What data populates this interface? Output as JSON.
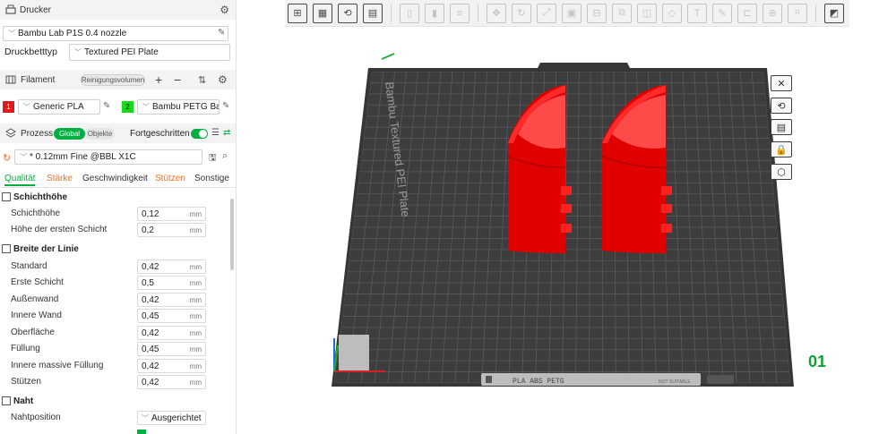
{
  "printer": {
    "section_title": "Drucker",
    "name": "Bambu Lab P1S 0.4 nozzle",
    "bed_type_label": "Druckbetttyp",
    "bed_type": "Textured PEI Plate"
  },
  "filament": {
    "section_title": "Filament",
    "flush_button": "Reinigungsvolumen",
    "slots": [
      {
        "number": "1",
        "name": "Generic PLA",
        "color": "#e01b1b"
      },
      {
        "number": "2",
        "name": "Bambu PETG Basic",
        "color": "#19d819"
      }
    ]
  },
  "process": {
    "section_title": "Prozess",
    "toggle_global": "Global",
    "toggle_objects": "Objekte",
    "advanced_label": "Fortgeschritten",
    "preset": "* 0.12mm Fine @BBL X1C"
  },
  "tabs": [
    {
      "label": "Qualität",
      "active": true
    },
    {
      "label": "Stärke",
      "active": false,
      "modified": true
    },
    {
      "label": "Geschwindigkeit",
      "active": false
    },
    {
      "label": "Stützen",
      "active": false,
      "modified": true
    },
    {
      "label": "Sonstige",
      "active": false
    }
  ],
  "groups": {
    "layer_height": {
      "title": "Schichthöhe",
      "rows": [
        {
          "label": "Schichthöhe",
          "value": "0,12",
          "unit": "mm"
        },
        {
          "label": "Höhe der ersten Schicht",
          "value": "0,2",
          "unit": "mm"
        }
      ]
    },
    "line_width": {
      "title": "Breite der Linie",
      "rows": [
        {
          "label": "Standard",
          "value": "0,42",
          "unit": "mm"
        },
        {
          "label": "Erste Schicht",
          "value": "0,5",
          "unit": "mm"
        },
        {
          "label": "Außenwand",
          "value": "0,42",
          "unit": "mm"
        },
        {
          "label": "Innere Wand",
          "value": "0,45",
          "unit": "mm"
        },
        {
          "label": "Oberfläche",
          "value": "0,42",
          "unit": "mm"
        },
        {
          "label": "Füllung",
          "value": "0,45",
          "unit": "mm"
        },
        {
          "label": "Innere massive Füllung",
          "value": "0,42",
          "unit": "mm"
        },
        {
          "label": "Stützen",
          "value": "0,42",
          "unit": "mm"
        }
      ]
    },
    "seam": {
      "title": "Naht",
      "rows": [
        {
          "label": "Nahtposition",
          "value": "Ausgerichtet"
        }
      ]
    }
  },
  "plate": {
    "logo_text": "Bambu Textured PEI Plate",
    "plate_number": "01",
    "bottom_bar_label": "PLA  ABS  PETG",
    "bottom_bar_warning": "NOT SUITABLE"
  },
  "colors": {
    "accent_green": "#00ae42",
    "model_red": "#f20000",
    "plate_dark": "#3a3a3a",
    "tab_modified": "#e8732b"
  }
}
